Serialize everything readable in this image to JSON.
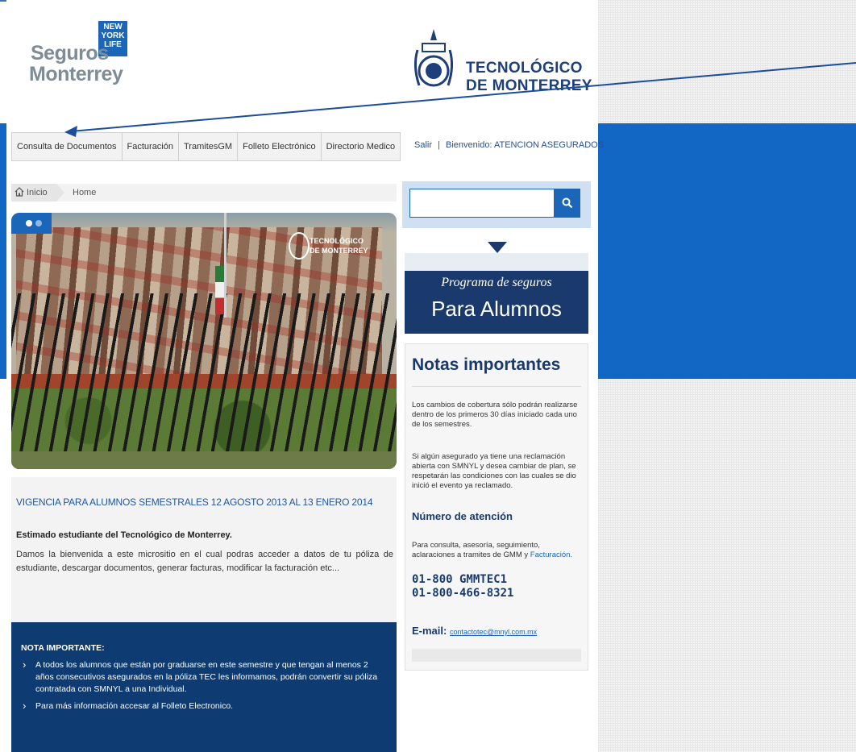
{
  "logos": {
    "seguros_line1": "Seguros",
    "seguros_line2": "Monterrey",
    "newyorklife": "NEW YORK LIFE",
    "tec_line1": "TECNOLÓGICO",
    "tec_line2": "DE MONTERREY"
  },
  "nav": {
    "items": [
      "Consulta de Documentos",
      "Facturación",
      "TramitesGM",
      "Folleto Electrónico",
      "Directorio Medico"
    ]
  },
  "user": {
    "logout": "Salir",
    "separator": "|",
    "welcome_label": "Bienvenido:",
    "welcome_user": "ATENCION ASEGURADOS"
  },
  "breadcrumb": {
    "home": "Inicio",
    "current": "Home"
  },
  "hero": {
    "overlay_logo_line1": "TECNOLÓGICO",
    "overlay_logo_line2": "DE MONTERREY"
  },
  "main": {
    "vigencia": "VIGENCIA PARA ALUMNOS SEMESTRALES 12 AGOSTO 2013 AL 13 ENERO 2014",
    "greeting": "Estimado estudiante del Tecnológico de Monterrey.",
    "intro": "Damos la bienvenida a este micrositio en el cual podras acceder a datos de tu póliza de estudiante, descargar documentos, generar facturas, modificar la facturación etc..."
  },
  "nota": {
    "heading": "NOTA IMPORTANTE:",
    "items": [
      "A todos los alumnos que están por graduarse en este semestre y que tengan al menos 2 años consecutivos asegurados en la póliza TEC les informamos, podrán convertir su póliza contratada con SMNYL a una Individual.",
      "Para más información accesar al Folleto Electronico."
    ]
  },
  "search": {
    "placeholder": ""
  },
  "promo": {
    "line1": "Programa de seguros",
    "line2": "Para Alumnos"
  },
  "notes": {
    "title": "Notas importantes",
    "p1": "Los cambios de cobertura sólo podrán realizarse dentro de los primeros 30 días iniciado cada uno de los semestres.",
    "p2": "Si algún asegurado ya tiene una reclamación abierta con SMNYL y desea cambiar de plan, se respetarán las condiciones con las cuales se dio inició el evento ya reclamado.",
    "attention_title": "Número de atención",
    "attention_text": "Para consulta, asesoría, seguimiento, aclaraciones a tramites de GMM y",
    "attention_link": "Facturación.",
    "phone1": "01-800 GMMTEC1",
    "phone2": "01-800-466-8321",
    "email_label": "E-mail:",
    "email": "contactotec@mnyl.com.mx"
  },
  "colors": {
    "accent": "#1b66b8",
    "navy": "#1a3a6d",
    "nota_bg": "#0e3b72",
    "band": "#1266c4"
  }
}
